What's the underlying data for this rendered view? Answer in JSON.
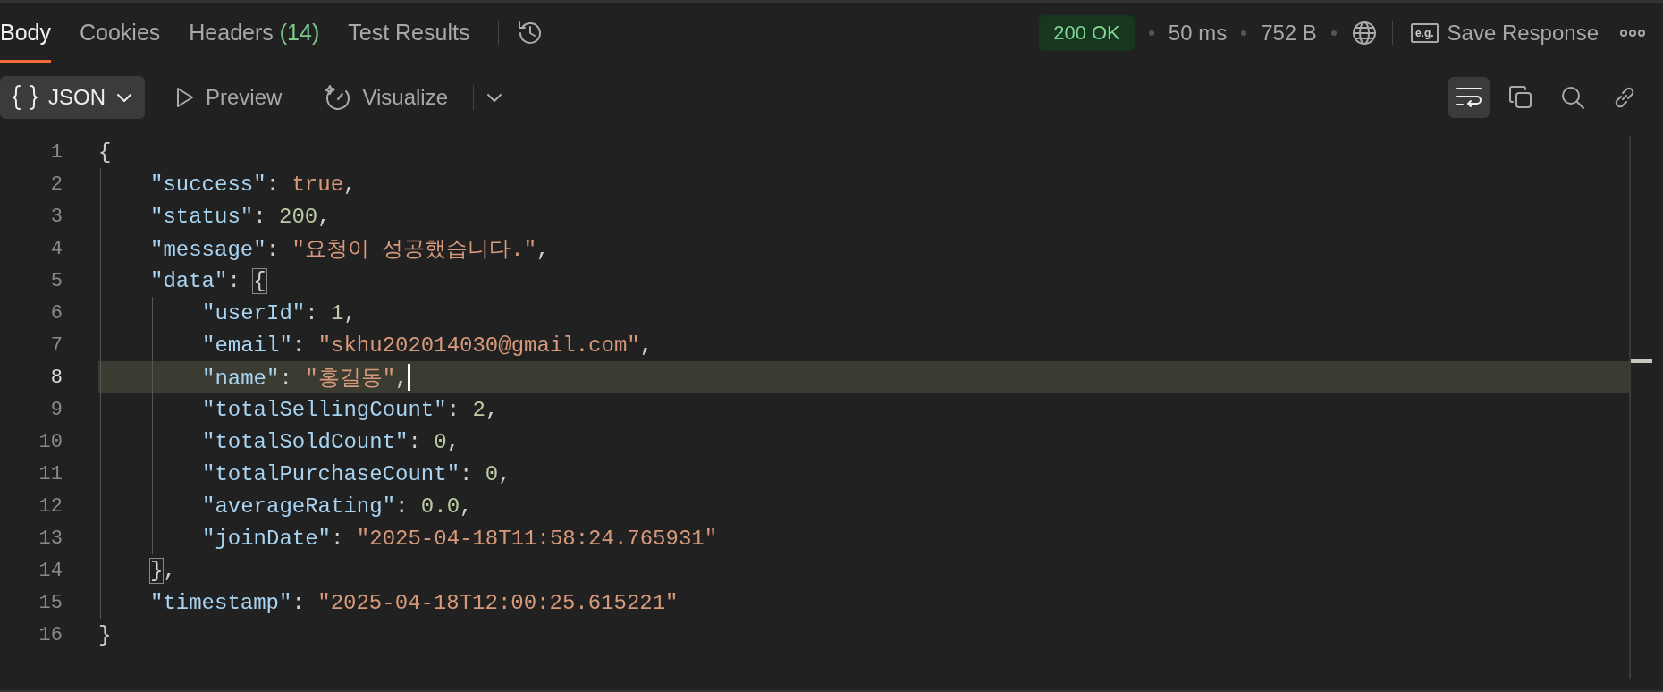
{
  "response_tabs": [
    {
      "label": "Body",
      "selected": true
    },
    {
      "label": "Cookies",
      "selected": false
    },
    {
      "label": "Headers",
      "count": "(14)",
      "selected": false
    },
    {
      "label": "Test Results",
      "selected": false
    }
  ],
  "status": {
    "code": "200 OK",
    "time": "50 ms",
    "size": "752 B",
    "example_tag": "e.g.",
    "save_label": "Save Response"
  },
  "view_modes": [
    {
      "kind": "format",
      "label": "JSON",
      "selected": true
    },
    {
      "kind": "preview",
      "label": "Preview",
      "selected": false
    },
    {
      "kind": "visualize",
      "label": "Visualize",
      "selected": false
    }
  ],
  "tools": [
    {
      "kind": "wrap",
      "selected": true
    },
    {
      "kind": "copy",
      "selected": false
    },
    {
      "kind": "search",
      "selected": false
    },
    {
      "kind": "link",
      "selected": false
    }
  ],
  "editor": {
    "lines": [
      {
        "number": "1",
        "current": false,
        "tokens": [
          {
            "kind": "punct",
            "text": "{"
          }
        ],
        "children": [
          {
            "number": "2",
            "current": false,
            "tokens": [
              {
                "kind": "key",
                "text": "\"success\""
              },
              {
                "kind": "punct",
                "text": ": "
              },
              {
                "kind": "literal",
                "text": "true"
              },
              {
                "kind": "punct",
                "text": ","
              }
            ]
          },
          {
            "number": "3",
            "current": false,
            "tokens": [
              {
                "kind": "key",
                "text": "\"status\""
              },
              {
                "kind": "punct",
                "text": ": "
              },
              {
                "kind": "number",
                "text": "200"
              },
              {
                "kind": "punct",
                "text": ","
              }
            ]
          },
          {
            "number": "4",
            "current": false,
            "tokens": [
              {
                "kind": "key",
                "text": "\"message\""
              },
              {
                "kind": "punct",
                "text": ": "
              },
              {
                "kind": "string",
                "text": "\"요청이 성공했습니다.\""
              },
              {
                "kind": "punct",
                "text": ","
              }
            ]
          },
          {
            "number": "5",
            "current": false,
            "tokens": [
              {
                "kind": "key",
                "text": "\"data\""
              },
              {
                "kind": "punct",
                "text": ": "
              },
              {
                "kind": "match",
                "text": "{"
              }
            ],
            "children": [
              {
                "number": "6",
                "current": false,
                "tokens": [
                  {
                    "kind": "key",
                    "text": "\"userId\""
                  },
                  {
                    "kind": "punct",
                    "text": ": "
                  },
                  {
                    "kind": "number",
                    "text": "1"
                  },
                  {
                    "kind": "punct",
                    "text": ","
                  }
                ]
              },
              {
                "number": "7",
                "current": false,
                "tokens": [
                  {
                    "kind": "key",
                    "text": "\"email\""
                  },
                  {
                    "kind": "punct",
                    "text": ": "
                  },
                  {
                    "kind": "string",
                    "text": "\"skhu202014030@gmail.com\""
                  },
                  {
                    "kind": "punct",
                    "text": ","
                  }
                ]
              },
              {
                "number": "8",
                "current": true,
                "tokens": [
                  {
                    "kind": "key",
                    "text": "\"name\""
                  },
                  {
                    "kind": "punct",
                    "text": ": "
                  },
                  {
                    "kind": "string",
                    "text": "\"홍길동\""
                  },
                  {
                    "kind": "punct",
                    "text": ","
                  }
                ]
              },
              {
                "number": "9",
                "current": false,
                "tokens": [
                  {
                    "kind": "key",
                    "text": "\"totalSellingCount\""
                  },
                  {
                    "kind": "punct",
                    "text": ": "
                  },
                  {
                    "kind": "number",
                    "text": "2"
                  },
                  {
                    "kind": "punct",
                    "text": ","
                  }
                ]
              },
              {
                "number": "10",
                "current": false,
                "tokens": [
                  {
                    "kind": "key",
                    "text": "\"totalSoldCount\""
                  },
                  {
                    "kind": "punct",
                    "text": ": "
                  },
                  {
                    "kind": "number",
                    "text": "0"
                  },
                  {
                    "kind": "punct",
                    "text": ","
                  }
                ]
              },
              {
                "number": "11",
                "current": false,
                "tokens": [
                  {
                    "kind": "key",
                    "text": "\"totalPurchaseCount\""
                  },
                  {
                    "kind": "punct",
                    "text": ": "
                  },
                  {
                    "kind": "number",
                    "text": "0"
                  },
                  {
                    "kind": "punct",
                    "text": ","
                  }
                ]
              },
              {
                "number": "12",
                "current": false,
                "tokens": [
                  {
                    "kind": "key",
                    "text": "\"averageRating\""
                  },
                  {
                    "kind": "punct",
                    "text": ": "
                  },
                  {
                    "kind": "number",
                    "text": "0.0"
                  },
                  {
                    "kind": "punct",
                    "text": ","
                  }
                ]
              },
              {
                "number": "13",
                "current": false,
                "tokens": [
                  {
                    "kind": "key",
                    "text": "\"joinDate\""
                  },
                  {
                    "kind": "punct",
                    "text": ": "
                  },
                  {
                    "kind": "string",
                    "text": "\"2025-04-18T11:58:24.765931\""
                  }
                ]
              }
            ]
          },
          {
            "number": "14",
            "current": false,
            "tokens": [
              {
                "kind": "match",
                "text": "}"
              },
              {
                "kind": "punct",
                "text": ","
              }
            ]
          },
          {
            "number": "15",
            "current": false,
            "tokens": [
              {
                "kind": "key",
                "text": "\"timestamp\""
              },
              {
                "kind": "punct",
                "text": ": "
              },
              {
                "kind": "string",
                "text": "\"2025-04-18T12:00:25.615221\""
              }
            ]
          }
        ]
      },
      {
        "number": "16",
        "current": false,
        "tokens": [
          {
            "kind": "punct",
            "text": "}"
          }
        ]
      }
    ]
  }
}
